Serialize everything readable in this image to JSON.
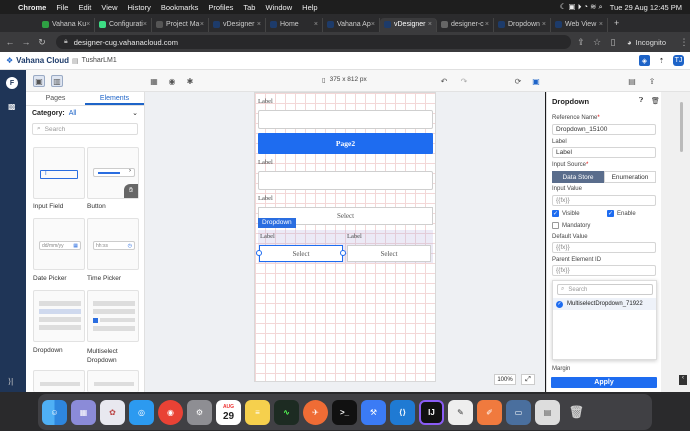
{
  "menubar": {
    "app": "Chrome",
    "items": [
      "File",
      "Edit",
      "View",
      "History",
      "Bookmarks",
      "Profiles",
      "Tab",
      "Window",
      "Help"
    ],
    "datetime": "Tue 29 Aug  12:45 PM"
  },
  "tabs": [
    {
      "label": "Vahana Ku",
      "color": "#2ea043"
    },
    {
      "label": "Configurati",
      "color": "#3ddc84"
    },
    {
      "label": "Project Ma",
      "color": "#555555"
    },
    {
      "label": "vDesigner",
      "color": "#1d3b6a"
    },
    {
      "label": "Home",
      "color": "#1d3b6a"
    },
    {
      "label": "Vahana Ap",
      "color": "#1d3b6a"
    },
    {
      "label": "vDesigner",
      "color": "#1d3b6a",
      "active": true
    },
    {
      "label": "designer-c",
      "color": "#666666"
    },
    {
      "label": "Dropdown",
      "color": "#1d3b6a"
    },
    {
      "label": "Web View",
      "color": "#1d3b6a"
    }
  ],
  "address": {
    "url": "designer-cug.vahanacloud.com",
    "incognito": "Incognito"
  },
  "appheader": {
    "logo": "Vahana Cloud",
    "project": "TusharLM1"
  },
  "toolbar": {
    "device": "375 x 812 px"
  },
  "rail": {
    "avatar": "F",
    "expand": "⟩|"
  },
  "panel": {
    "tabs": [
      "Pages",
      "Elements"
    ],
    "category_label": "Category:",
    "category_value": "All",
    "search_placeholder": "Search",
    "elements": [
      "Input Field",
      "Button",
      "Date Picker",
      "Time Picker",
      "Dropdown",
      "Multiselect Dropdown"
    ],
    "datepicker_placeholder": "dd/mm/yy",
    "timepicker_placeholder": "hh:ss"
  },
  "canvas": {
    "label": "Label",
    "page_button": "Page2",
    "select": "Select",
    "selected_badge": "Dropdown",
    "zoom": "100%"
  },
  "props": {
    "title": "Dropdown",
    "ref_label": "Reference Name",
    "ref_value": "Dropdown_15100",
    "label_label": "Label",
    "label_value": "Label",
    "source_label": "Input Source",
    "source_options": [
      "Data Store",
      "Enumeration"
    ],
    "input_value_label": "Input Value",
    "input_value": "{{fx}}",
    "visible": "Visible",
    "enable": "Enable",
    "mandatory": "Mandatory",
    "default_label": "Default Value",
    "default_value": "{{fx}}",
    "parent_label": "Parent Element ID",
    "parent_value": "{{fx}}",
    "dropdown_search": "Search",
    "dropdown_option": "MultiselectDropdown_71922",
    "margin": "Margin",
    "apply": "Apply"
  },
  "dock": {
    "calendar_month": "AUG",
    "calendar_day": "29"
  }
}
